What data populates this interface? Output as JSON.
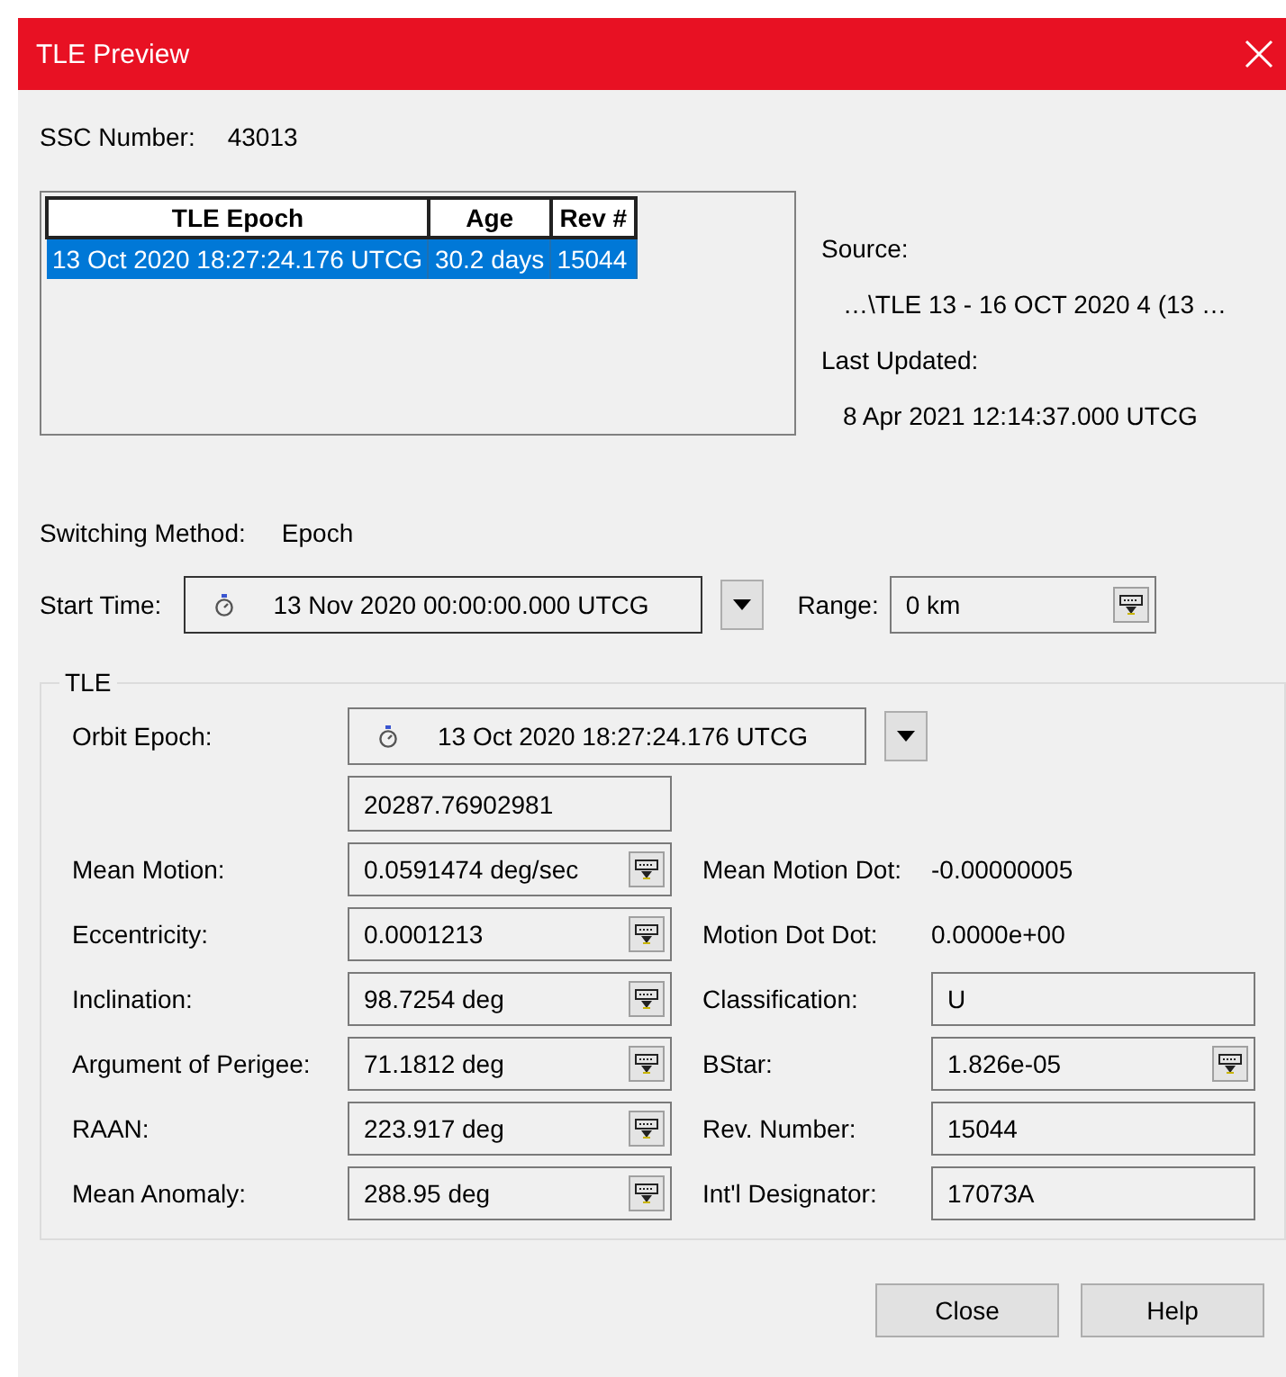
{
  "window": {
    "title": "TLE Preview"
  },
  "ssc": {
    "label": "SSC Number:",
    "value": "43013"
  },
  "epochs_table": {
    "columns": [
      "TLE Epoch",
      "Age",
      "Rev #"
    ],
    "rows": [
      {
        "cells": [
          "13 Oct 2020 18:27:24.176 UTCG",
          "30.2 days",
          "15044"
        ],
        "selected": true
      }
    ]
  },
  "source": {
    "label": "Source:",
    "value": "…\\TLE 13 - 16 OCT 2020 4 (13 …"
  },
  "last_updated": {
    "label": "Last Updated:",
    "value": "8 Apr 2021 12:14:37.000 UTCG"
  },
  "switching_method": {
    "label": "Switching Method:",
    "value": "Epoch"
  },
  "start_time": {
    "label": "Start Time:",
    "value": "13 Nov 2020 00:00:00.000 UTCG"
  },
  "range": {
    "label": "Range:",
    "value": "0 km"
  },
  "tle": {
    "title": "TLE",
    "orbit_epoch": {
      "label": "Orbit Epoch:",
      "value": "13 Oct 2020 18:27:24.176 UTCG"
    },
    "epoch_number": "20287.76902981",
    "left_fields": [
      {
        "label": "Mean Motion:",
        "value": "0.0591474 deg/sec"
      },
      {
        "label": "Eccentricity:",
        "value": "0.0001213"
      },
      {
        "label": "Inclination:",
        "value": "98.7254 deg"
      },
      {
        "label": "Argument of Perigee:",
        "value": "71.1812 deg"
      },
      {
        "label": "RAAN:",
        "value": "223.917 deg"
      },
      {
        "label": "Mean Anomaly:",
        "value": "288.95 deg"
      }
    ],
    "right_fields": [
      {
        "label": "Mean Motion Dot:",
        "value": "-0.00000005",
        "kind": "text"
      },
      {
        "label": "Motion Dot Dot:",
        "value": "0.0000e+00",
        "kind": "text"
      },
      {
        "label": "Classification:",
        "value": "U",
        "kind": "field"
      },
      {
        "label": "BStar:",
        "value": "1.826e-05",
        "kind": "spin"
      },
      {
        "label": "Rev. Number:",
        "value": "15044",
        "kind": "field"
      },
      {
        "label": "Int'l Designator:",
        "value": "17073A",
        "kind": "field"
      }
    ]
  },
  "buttons": [
    "Close",
    "Help"
  ]
}
